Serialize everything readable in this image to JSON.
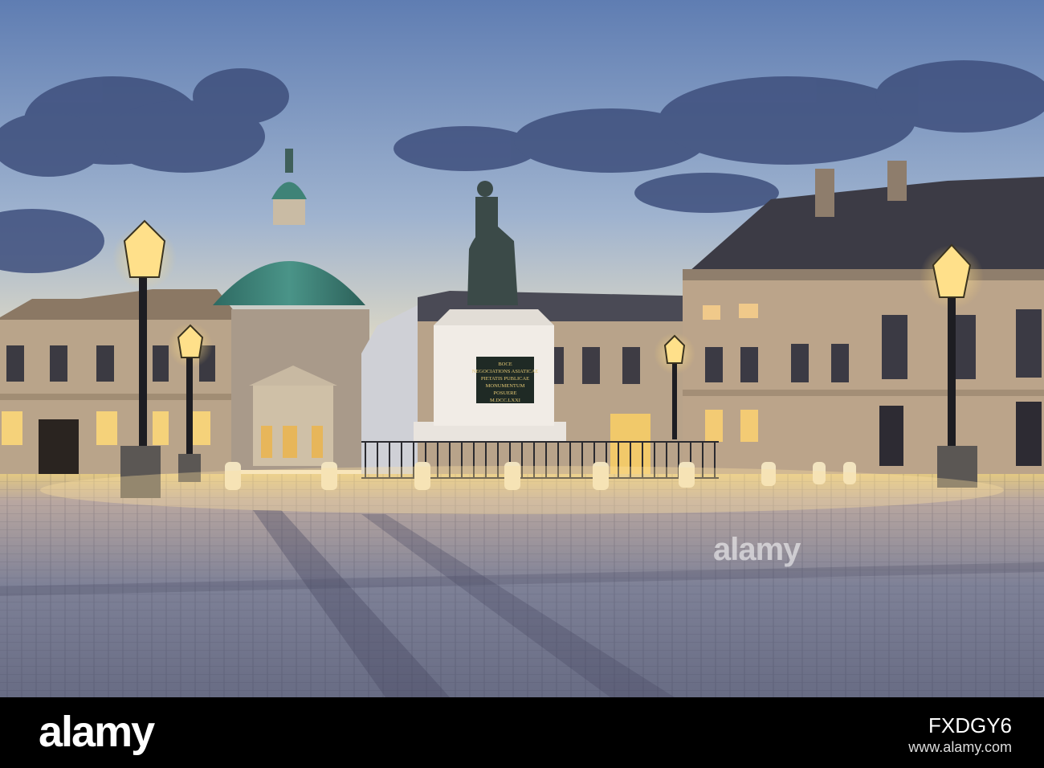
{
  "watermark": {
    "center_text": "alamy"
  },
  "footer": {
    "logo_text": "alamy",
    "image_id": "FXDGY6",
    "url_text": "www.alamy.com"
  },
  "plaque": {
    "lines": [
      "BOCE",
      "NEGOCIATIONS ASIATICAE",
      "PIETATIS PUBLICAE",
      "MONUMENTUM",
      "POSUERE",
      "M.DCC.LXXI"
    ]
  },
  "colors": {
    "sky_top": "#6b86b8",
    "sky_horizon": "#f3e6c4",
    "dome": "#3e7f74",
    "building": "#b9a48a",
    "lamp": "#ffd36a",
    "cobble": "#7e8197"
  }
}
